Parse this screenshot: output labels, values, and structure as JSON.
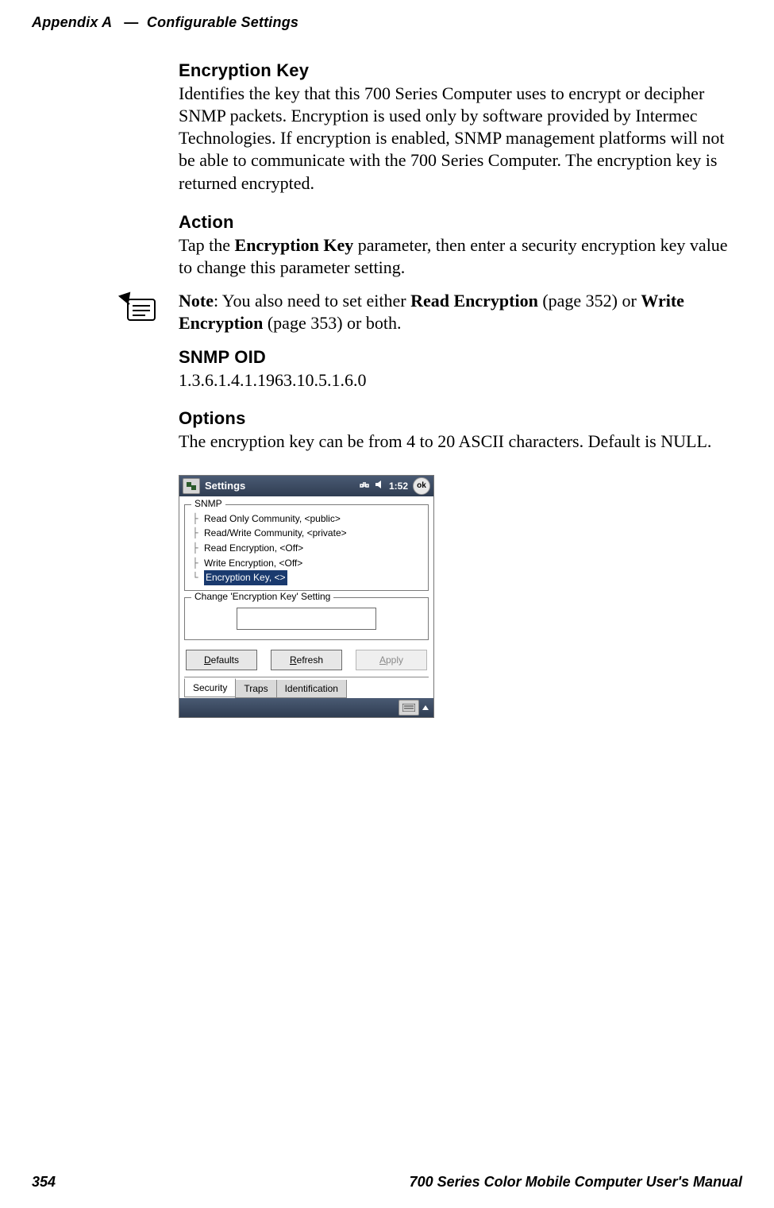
{
  "header": {
    "appendix": "Appendix",
    "letter": "A",
    "dash": "—",
    "section": "Configurable Settings"
  },
  "footer": {
    "page": "354",
    "manual": "700 Series Color Mobile Computer User's Manual"
  },
  "sec1": {
    "title": "Encryption Key",
    "body": "Identifies the key that this 700 Series Computer uses to encrypt or decipher SNMP packets. Encryption is used only by software provided by Intermec Technologies. If encryption is enabled, SNMP management platforms will not be able to communicate with the 700 Series Computer. The encryption key is returned encrypted."
  },
  "sec2": {
    "title": "Action",
    "body_pre": "Tap the ",
    "body_bold": "Encryption Key",
    "body_post": " parameter, then enter a security encryption key value to change this parameter setting."
  },
  "note": {
    "label": "Note",
    "pre": ": You also need to set either ",
    "b1": "Read Encryption",
    "mid1": " (page 352) or ",
    "b2": "Write Encryption",
    "mid2": " (page 353) or both."
  },
  "sec3": {
    "title": "SNMP OID",
    "body": "1.3.6.1.4.1.1963.10.5.1.6.0"
  },
  "sec4": {
    "title": "Options",
    "body": "The encryption key can be from 4 to 20 ASCII characters. Default is NULL."
  },
  "device": {
    "titlebar": {
      "title": "Settings",
      "time": "1:52",
      "ok": "ok"
    },
    "snmp_legend": "SNMP",
    "tree": [
      "Read Only Community, <public>",
      "Read/Write Community, <private>",
      "Read Encryption, <Off>",
      "Write Encryption, <Off>",
      "Encryption Key, <>"
    ],
    "selected_index": 4,
    "change_legend": "Change 'Encryption Key' Setting",
    "input_value": "",
    "buttons": {
      "defaults": "Defaults",
      "refresh": "Refresh",
      "apply": "Apply"
    },
    "tabs": [
      "Security",
      "Traps",
      "Identification"
    ],
    "active_tab_index": 0
  }
}
